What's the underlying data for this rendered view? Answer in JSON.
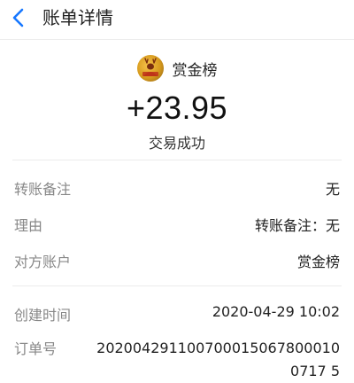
{
  "header": {
    "title": "账单详情"
  },
  "summary": {
    "merchant_name": "赏金榜",
    "amount": "+23.95",
    "status": "交易成功",
    "avatar_icon": "gold-deer-logo-icon"
  },
  "details_group1": [
    {
      "label": "转账备注",
      "value": "无"
    },
    {
      "label": "理由",
      "value": "转账备注：无"
    },
    {
      "label": "对方账户",
      "value": "赏金榜"
    }
  ],
  "details_group2": [
    {
      "label": "创建时间",
      "value": "2020-04-29 10:02"
    },
    {
      "label": "订单号",
      "value": "2020042911007000150678000100717 5"
    }
  ],
  "colors": {
    "accent": "#1677ff",
    "label_gray": "#888888",
    "text": "#222222",
    "divider": "#ececec"
  }
}
